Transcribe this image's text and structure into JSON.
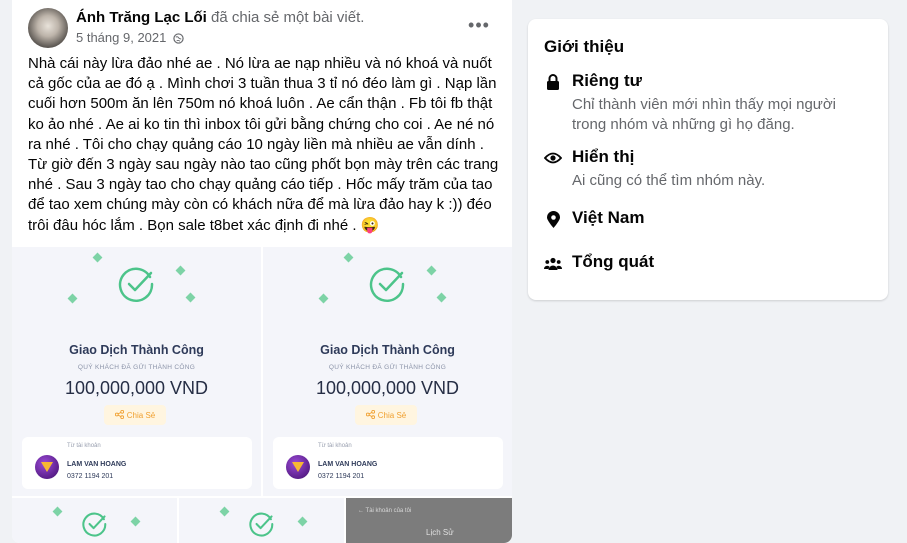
{
  "post": {
    "author": "Ánh Trăng Lạc Lối",
    "action": " đã chia sẻ một bài viết.",
    "date": "5 tháng 9, 2021",
    "more_label": "•••",
    "body": "Nhà cái này lừa đảo nhé ae . Nó lừa ae nạp nhiều và nó khoá và nuốt cả gốc của ae đó ạ . Mình chơi 3 tuần thua 3 tỉ nó đéo làm gì . Nạp lần cuối hơn 500m ăn lên 750m nó khoá luôn . Ae cẩn thận . Fb tôi fb thật ko ảo nhé . Ae ai ko tin thì inbox tôi gửi bằng chứng cho coi . Ae né nó ra nhé . Tôi cho chạy quảng cáo 10 ngày liền mà nhiều ae vẫn dính . Từ giờ đến 3 ngày sau ngày nào tao cũng phốt bọn mày trên các trang nhé . Sau 3 ngày tao cho chạy quảng cáo tiếp . Hốc mấy trăm của tao để tao xem chúng mày còn có khách nữa để mà lừa đảo hay k :)) đéo trôi đâu hóc lắm . Bọn sale t8bet xác định đi nhé . 😜"
  },
  "receipts": [
    {
      "title": "Giao Dịch Thành Công",
      "subtitle": "QUÝ KHÁCH ĐÃ GỬI THÀNH CÔNG",
      "amount": "100,000,000 VND",
      "share": "Chia Sẻ",
      "from_label": "Từ tài khoản",
      "name": "LAM VAN HOANG",
      "phone": "0372 1194 201"
    },
    {
      "title": "Giao Dịch Thành Công",
      "subtitle": "QUÝ KHÁCH ĐÃ GỬI THÀNH CÔNG",
      "amount": "100,000,000 VND",
      "share": "Chia Sẻ",
      "from_label": "Từ tài khoản",
      "name": "LAM VAN HOANG",
      "phone": "0372 1194 201"
    }
  ],
  "receipt_extra": {
    "back_label": "← Tài khoản của tôi",
    "history": "Lịch Sử"
  },
  "about": {
    "title": "Giới thiệu",
    "items": [
      {
        "icon": "lock-icon",
        "label": "Riêng tư",
        "desc": "Chỉ thành viên mới nhìn thấy mọi người trong nhóm và những gì họ đăng."
      },
      {
        "icon": "eye-icon",
        "label": "Hiển thị",
        "desc": "Ai cũng có thể tìm nhóm này."
      },
      {
        "icon": "location-pin-icon",
        "label": "Việt Nam",
        "desc": ""
      },
      {
        "icon": "people-icon",
        "label": "Tổng quát",
        "desc": ""
      }
    ]
  },
  "colors": {
    "background": "#f0f2f5",
    "card": "#ffffff",
    "secondary_text": "#65676b",
    "check_green": "#4cc48a"
  }
}
